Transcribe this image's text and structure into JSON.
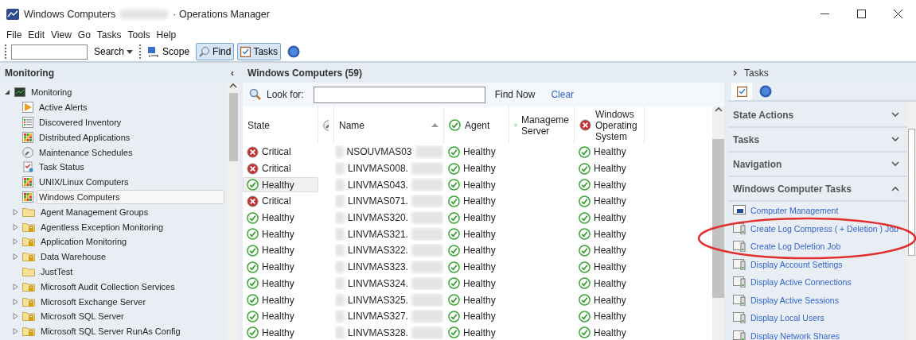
{
  "window": {
    "title_start": "Windows Computers",
    "title_end": "· Operations Manager"
  },
  "menu": [
    "File",
    "Edit",
    "View",
    "Go",
    "Tasks",
    "Tools",
    "Help"
  ],
  "toolbar": {
    "search_label": "Search",
    "scope": "Scope",
    "find": {
      "label": "Find",
      "selected": true
    },
    "tasks": {
      "label": "Tasks",
      "selected": true
    }
  },
  "navigation": {
    "title": "Monitoring",
    "collapse": "‹",
    "tree": [
      {
        "label": "Monitoring",
        "kind": "monitor",
        "expanded": true,
        "children": [
          {
            "label": "Active Alerts",
            "kind": "alert",
            "selected": false
          },
          {
            "label": "Discovered Inventory",
            "kind": "list",
            "selected": false
          },
          {
            "label": "Distributed Applications",
            "kind": "grid",
            "selected": false
          },
          {
            "label": "Maintenance Schedules",
            "kind": "wrench",
            "selected": false
          },
          {
            "label": "Task Status",
            "kind": "task",
            "selected": false
          },
          {
            "label": "UNIX/Linux Computers",
            "kind": "grid",
            "selected": false
          },
          {
            "label": "Windows Computers",
            "kind": "grid",
            "selected": true
          },
          {
            "label": "Agent Management Groups",
            "kind": "folder",
            "expanded": false,
            "selected": false
          },
          {
            "label": "Agentless Exception Monitoring",
            "kind": "locked-folder",
            "expanded": false,
            "selected": false
          },
          {
            "label": "Application Monitoring",
            "kind": "locked-folder",
            "expanded": false,
            "selected": false
          },
          {
            "label": "Data Warehouse",
            "kind": "locked-folder",
            "expanded": false,
            "selected": false
          },
          {
            "label": "JustTest",
            "kind": "folder",
            "selected": false
          },
          {
            "label": "Microsoft Audit Collection Services",
            "kind": "locked-folder",
            "expanded": false,
            "selected": false
          },
          {
            "label": "Microsoft Exchange Server",
            "kind": "locked-folder",
            "expanded": false,
            "selected": false
          },
          {
            "label": "Microsoft SQL Server",
            "kind": "locked-folder",
            "expanded": false,
            "selected": false
          },
          {
            "label": "Microsoft SQL Server RunAs Config",
            "kind": "locked-folder",
            "expanded": false,
            "selected": false
          }
        ]
      }
    ]
  },
  "results": {
    "title": "Windows Computers (59)",
    "look_for": "Look for:",
    "find_now": "Find Now",
    "clear": "Clear",
    "columns": [
      {
        "kind": "text",
        "lines": [
          "State"
        ]
      },
      {
        "kind": "wrench"
      },
      {
        "kind": "sorted",
        "lines": [
          "Name"
        ]
      },
      {
        "kind": "healthy",
        "lines": [
          "Agent"
        ]
      },
      {
        "kind": "healthy",
        "lines": [
          "Manageme",
          "Server"
        ]
      },
      {
        "kind": "critical",
        "lines": [
          "Windows",
          "Operating",
          "System"
        ]
      }
    ],
    "rows": [
      {
        "state": {
          "text": "Critical",
          "kind": "critical"
        },
        "selected": false,
        "name": "NSOUVMAS03",
        "agent": "Healthy",
        "os": "Healthy"
      },
      {
        "state": {
          "text": "Critical",
          "kind": "critical"
        },
        "selected": false,
        "name": "LINVMAS008.",
        "agent": "Healthy",
        "os": "Healthy"
      },
      {
        "state": {
          "text": "Healthy",
          "kind": "healthy"
        },
        "selected": true,
        "name": "LINVMAS043.",
        "agent": "Healthy",
        "os": "Healthy"
      },
      {
        "state": {
          "text": "Critical",
          "kind": "critical"
        },
        "selected": false,
        "name": "LINVMAS071.",
        "agent": "Healthy",
        "os": "Healthy"
      },
      {
        "state": {
          "text": "Healthy",
          "kind": "healthy"
        },
        "selected": false,
        "name": "LINVMAS320.",
        "agent": "Healthy",
        "os": "Healthy"
      },
      {
        "state": {
          "text": "Healthy",
          "kind": "healthy"
        },
        "selected": false,
        "name": "LINVMAS321.",
        "agent": "Healthy",
        "os": "Healthy"
      },
      {
        "state": {
          "text": "Healthy",
          "kind": "healthy"
        },
        "selected": false,
        "name": "LINVMAS322.",
        "agent": "Healthy",
        "os": "Healthy"
      },
      {
        "state": {
          "text": "Healthy",
          "kind": "healthy"
        },
        "selected": false,
        "name": "LINVMAS323.",
        "agent": "Healthy",
        "os": "Healthy"
      },
      {
        "state": {
          "text": "Healthy",
          "kind": "healthy"
        },
        "selected": false,
        "name": "LINVMAS324.",
        "agent": "Healthy",
        "os": "Healthy"
      },
      {
        "state": {
          "text": "Healthy",
          "kind": "healthy"
        },
        "selected": false,
        "name": "LINVMAS325.",
        "agent": "Healthy",
        "os": "Healthy"
      },
      {
        "state": {
          "text": "Healthy",
          "kind": "healthy"
        },
        "selected": false,
        "name": "LINVMAS327.",
        "agent": "Healthy",
        "os": "Healthy"
      },
      {
        "state": {
          "text": "Healthy",
          "kind": "healthy"
        },
        "selected": false,
        "name": "LINVMAS328.",
        "agent": "Healthy",
        "os": "Healthy"
      }
    ]
  },
  "tasks_pane": {
    "title": "Tasks",
    "tabs": [
      {
        "kind": "tasks",
        "selected": true
      },
      {
        "kind": "help",
        "selected": false
      }
    ],
    "sections": [
      {
        "title": "State Actions",
        "expanded": false
      },
      {
        "title": "Tasks",
        "expanded": false
      },
      {
        "title": "Navigation",
        "expanded": false
      },
      {
        "title": "Windows Computer Tasks",
        "expanded": true,
        "items": [
          {
            "label": "Computer Management",
            "kind": "computer"
          },
          {
            "label": "Create Log Compress ( + Deletion ) Job",
            "kind": "script"
          },
          {
            "label": "Create Log Deletion Job",
            "kind": "script"
          },
          {
            "label": "Display Account Settings",
            "kind": "script"
          },
          {
            "label": "Display Active Connections",
            "kind": "script"
          },
          {
            "label": "Display Active Sessions",
            "kind": "script"
          },
          {
            "label": "Display Local Users",
            "kind": "script"
          },
          {
            "label": "Display Network Shares",
            "kind": "script"
          }
        ]
      }
    ]
  }
}
